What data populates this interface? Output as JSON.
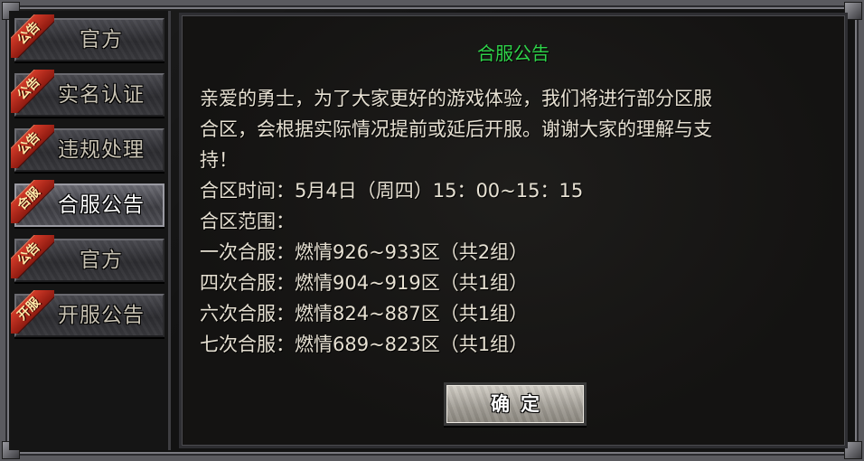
{
  "sidebar": {
    "tabs": [
      {
        "ribbon": "公告",
        "label": "官方",
        "active": false
      },
      {
        "ribbon": "公告",
        "label": "实名认证",
        "active": false
      },
      {
        "ribbon": "公告",
        "label": "违规处理",
        "active": false
      },
      {
        "ribbon": "合服",
        "label": "合服公告",
        "active": true
      },
      {
        "ribbon": "公告",
        "label": "官方",
        "active": false
      },
      {
        "ribbon": "开服",
        "label": "开服公告",
        "active": false
      }
    ]
  },
  "notice": {
    "title": "合服公告",
    "lines": [
      "亲爱的勇士，为了大家更好的游戏体验，我们将进行部分区服",
      "合区，会根据实际情况提前或延后开服。谢谢大家的理解与支",
      "持！",
      "合区时间：5月4日（周四）15：00~15：15",
      "合区范围：",
      "一次合服：燃情926~933区（共2组）",
      "四次合服：燃情904~919区（共1组）",
      "六次合服：燃情824~887区（共1组）",
      "七次合服：燃情689~823区（共1组）"
    ],
    "confirm_label": "确定"
  },
  "colors": {
    "title": "#2fd44a",
    "ribbon": "#c0301f",
    "text": "#e6e0d2"
  }
}
